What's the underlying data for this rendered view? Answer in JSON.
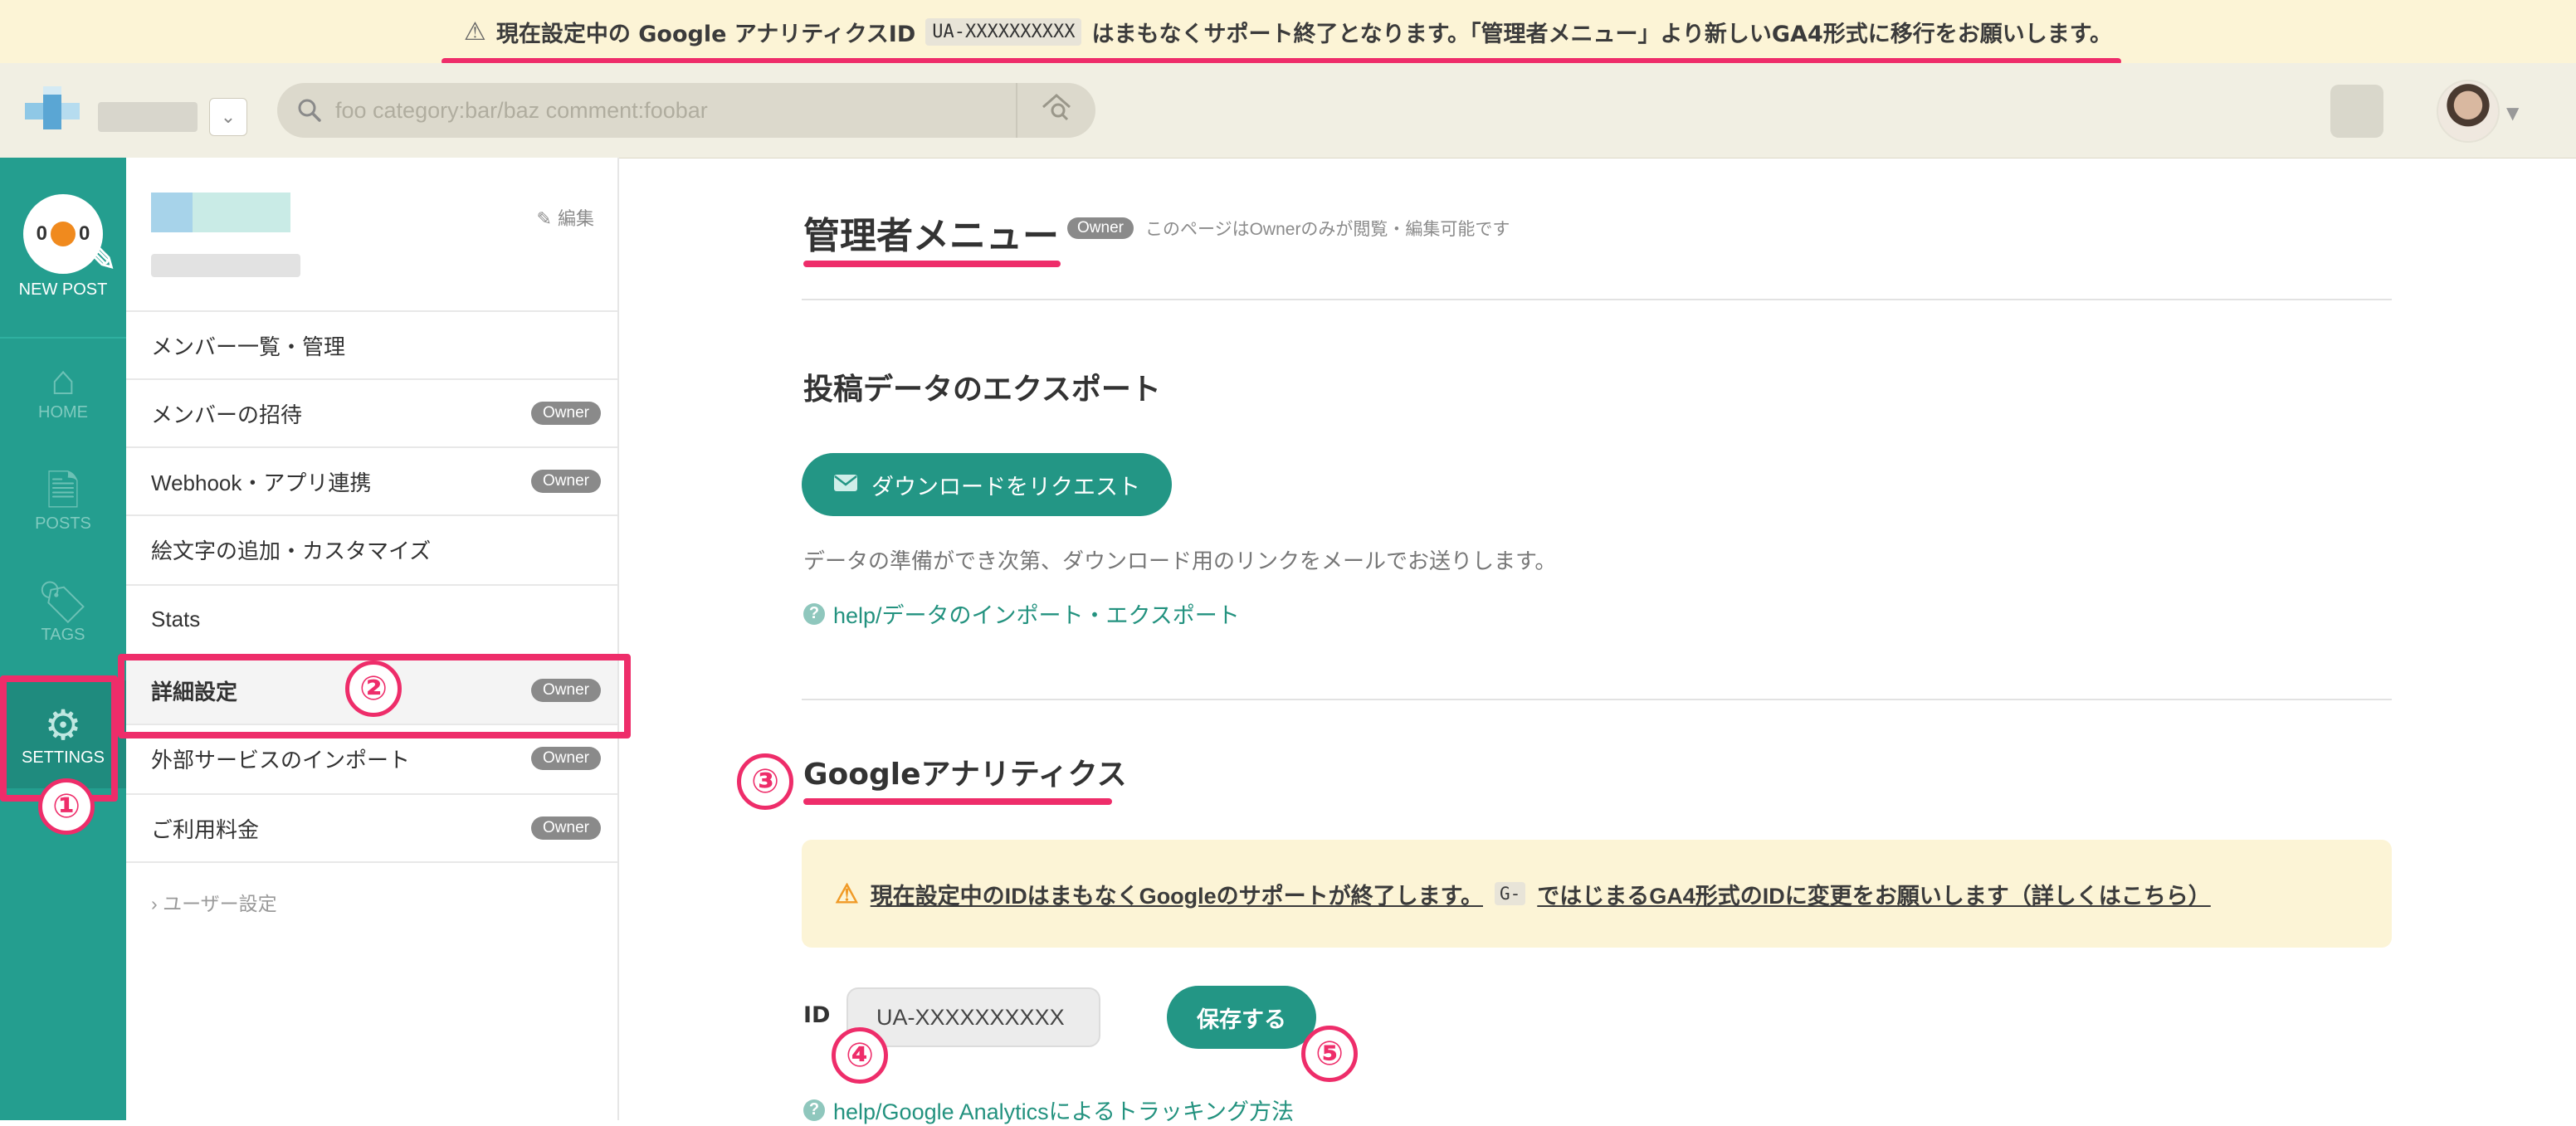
{
  "banner": {
    "prefix": "現在設定中の Google アナリティクスID",
    "code": "UA-XXXXXXXXXX",
    "suffix": "はまもなくサポート終了となります。「管理者メニュー」より新しいGA4形式に移行をお願いします。"
  },
  "header": {
    "search_placeholder": "foo category:bar/baz comment:foobar"
  },
  "rail": {
    "newpost_count_left": "0",
    "newpost_count_right": "0",
    "newpost": "NEW POST",
    "home": "HOME",
    "posts": "POSTS",
    "tags": "TAGS",
    "settings": "SETTINGS"
  },
  "subnav": {
    "edit": "編集",
    "items": [
      {
        "label": "メンバー一覧・管理",
        "badge": ""
      },
      {
        "label": "メンバーの招待",
        "badge": "Owner"
      },
      {
        "label": "Webhook・アプリ連携",
        "badge": "Owner"
      },
      {
        "label": "絵文字の追加・カスタマイズ",
        "badge": ""
      },
      {
        "label": "Stats",
        "badge": ""
      },
      {
        "label": "詳細設定",
        "badge": "Owner"
      },
      {
        "label": "外部サービスのインポート",
        "badge": "Owner"
      },
      {
        "label": "ご利用料金",
        "badge": "Owner"
      }
    ],
    "user_settings": "ユーザー設定"
  },
  "main": {
    "title": "管理者メニュー",
    "title_badge": "Owner",
    "title_note": "このページはOwnerのみが閲覧・編集可能です",
    "export": {
      "title": "投稿データのエクスポート",
      "button": "ダウンロードをリクエスト",
      "desc": "データの準備ができ次第、ダウンロード用のリンクをメールでお送りします。",
      "help": "help/データのインポート・エクスポート"
    },
    "ga": {
      "title": "Googleアナリティクス",
      "alert_prefix": "現在設定中のIDはまもなくGoogleのサポートが終了します。",
      "alert_code": "G-",
      "alert_suffix": "ではじまるGA4形式のIDに変更をお願いします（詳しくはこちら）",
      "id_label": "ID",
      "id_value": "UA-XXXXXXXXXX",
      "save": "保存する",
      "help": "help/Google Analyticsによるトラッキング方法"
    }
  },
  "annotations": [
    "①",
    "②",
    "③",
    "④",
    "⑤"
  ],
  "colors": {
    "teal": "#249e8f",
    "annotation": "#ee2d6a",
    "banner_bg": "#fcf4d6"
  }
}
